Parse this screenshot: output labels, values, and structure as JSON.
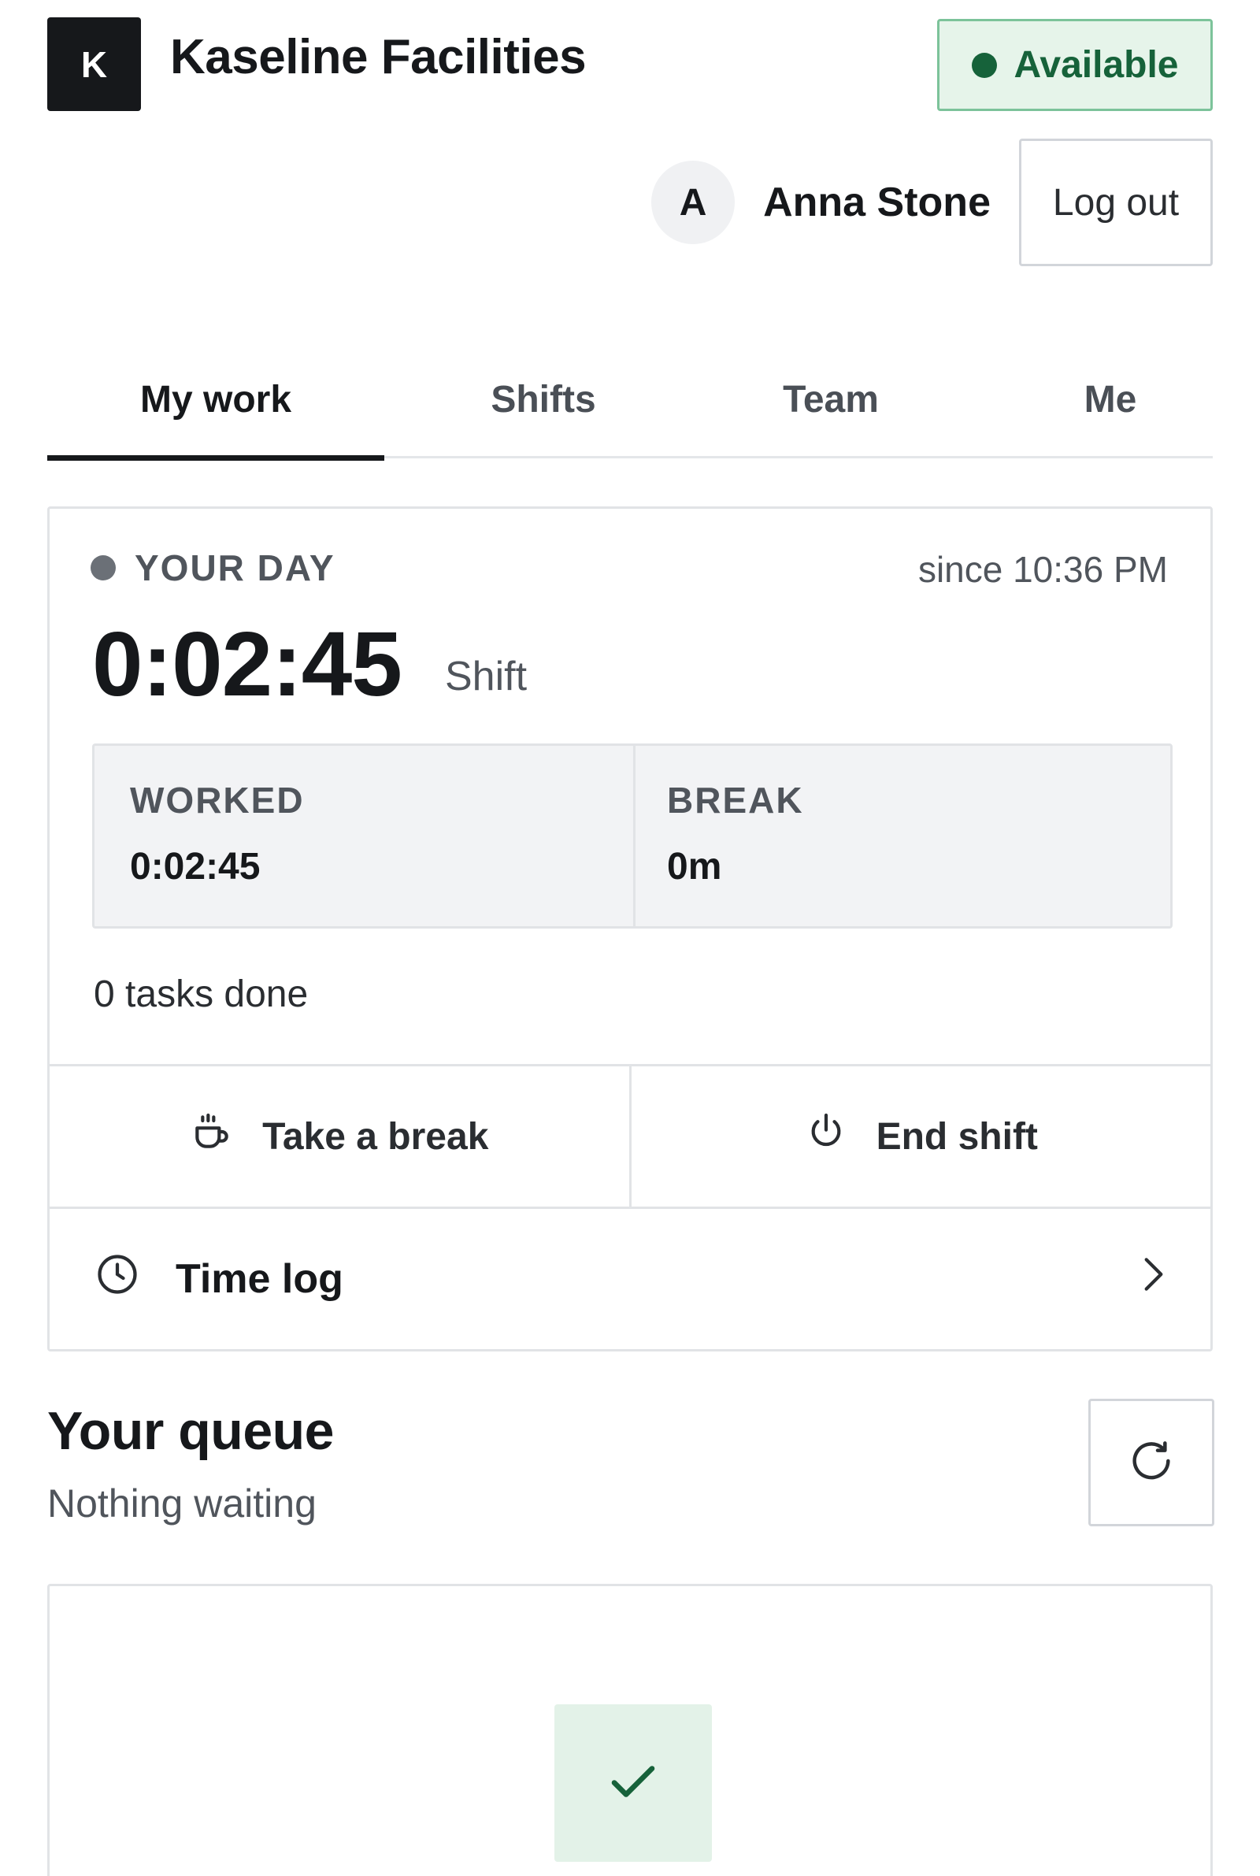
{
  "header": {
    "logo_letter": "K",
    "app_title": "Kaseline Facilities",
    "status_label": "Available",
    "status_color": "#16623a"
  },
  "user": {
    "avatar_letter": "A",
    "name": "Anna Stone",
    "logout_label": "Log out"
  },
  "tabs": [
    {
      "label": "My work",
      "active": true
    },
    {
      "label": "Shifts",
      "active": false
    },
    {
      "label": "Team",
      "active": false
    },
    {
      "label": "Me",
      "active": false
    }
  ],
  "day": {
    "label": "YOUR DAY",
    "since": "since 10:36 PM",
    "time": "0:02:45",
    "time_unit": "Shift",
    "worked_label": "WORKED",
    "worked_value": "0:02:45",
    "break_label": "BREAK",
    "break_value": "0m",
    "tasks_done": "0 tasks done",
    "take_break_label": "Take a break",
    "end_shift_label": "End shift",
    "time_log_label": "Time log"
  },
  "queue": {
    "title": "Your queue",
    "subtitle": "Nothing waiting",
    "empty_icon": "check-icon"
  },
  "colors": {
    "accent_dark": "#16181b",
    "success": "#16623a",
    "success_bg": "#e3f2e8"
  }
}
